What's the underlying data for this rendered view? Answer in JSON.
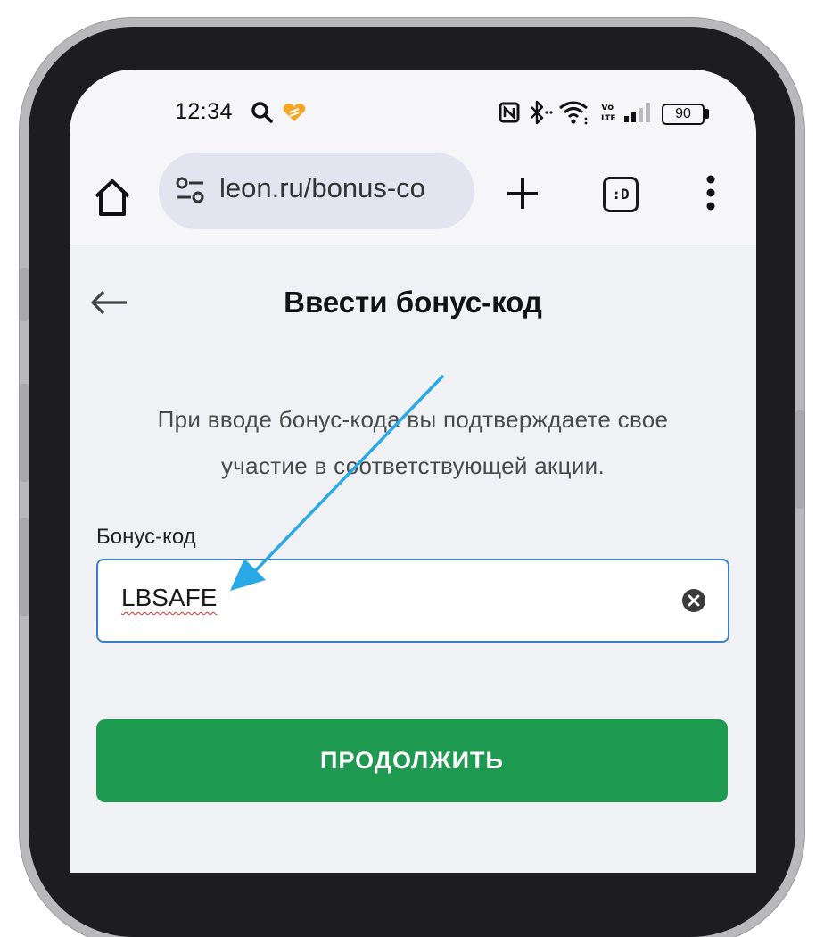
{
  "status_bar": {
    "time": "12:34",
    "battery": "90",
    "icons": [
      "search-icon",
      "heart-icon",
      "nfc-icon",
      "bluetooth-icon",
      "wifi-icon",
      "volte-icon",
      "signal-icon",
      "battery-icon"
    ]
  },
  "browser": {
    "url": "leon.ru/bonus-co",
    "tabs_label": ":D",
    "icons": [
      "home-icon",
      "site-settings-icon",
      "plus-icon",
      "more-vertical-icon"
    ]
  },
  "page": {
    "title": "Ввести бонус-код",
    "info_line1": "При вводе бонус-кода вы подтверждаете свое",
    "info_line2": "участие в соответствующей акции.",
    "field_label": "Бонус-код",
    "field_value": "LBSAFE",
    "continue_label": "ПРОДОЛЖИТЬ"
  },
  "colors": {
    "accent_green": "#1d9a50",
    "input_border": "#3d7fc4",
    "annotation_arrow": "#29a8e6",
    "heart": "#f5a623"
  }
}
